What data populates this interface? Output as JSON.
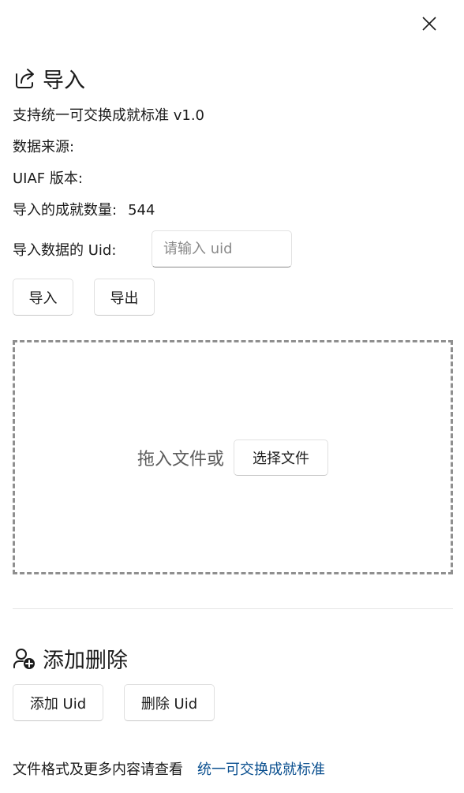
{
  "import_section": {
    "title": "导入",
    "icon": "share-export-icon",
    "standard_line": "支持统一可交换成就标准 v1.0",
    "source_label": "数据来源:",
    "uiaf_version_label": "UIAF 版本:",
    "count_label": "导入的成就数量:",
    "count_value": "544",
    "uid_label": "导入数据的 Uid:",
    "uid_placeholder": "请输入 uid",
    "uid_value": "",
    "import_button": "导入",
    "export_button": "导出"
  },
  "drop_zone": {
    "text": "拖入文件或",
    "choose_button": "选择文件"
  },
  "manage_section": {
    "title": "添加删除",
    "icon": "person-add-icon",
    "add_button": "添加 Uid",
    "delete_button": "删除 Uid"
  },
  "footer": {
    "text": "文件格式及更多内容请查看",
    "link": "统一可交换成就标准"
  },
  "colors": {
    "link": "#0a4f8f",
    "text": "#1b1b1b",
    "drop_border": "#8f8f8f"
  }
}
